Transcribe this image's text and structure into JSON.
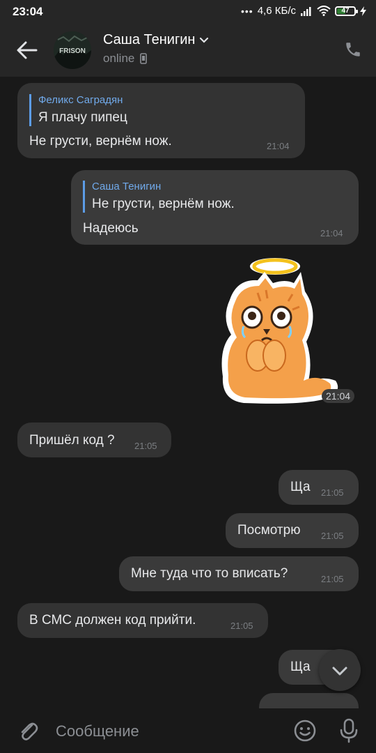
{
  "status_bar": {
    "time": "23:04",
    "dots": "•••",
    "network_speed": "4,6 КБ/с",
    "battery_percent": "47",
    "battery_level": 0.47
  },
  "header": {
    "contact_name": "Саша Тенигин",
    "status": "online",
    "avatar_text": "FRISON"
  },
  "messages": [
    {
      "id": 1,
      "direction": "in",
      "reply_author": "Феликс Саградян",
      "reply_text": "Я плачу пипец",
      "text": "Не грусти, вернём нож.",
      "time": "21:04"
    },
    {
      "id": 2,
      "direction": "out",
      "reply_author": "Саша Тенигин",
      "reply_text": "Не грусти, вернём нож.",
      "text": "Надеюсь",
      "time": "21:04"
    },
    {
      "id": 3,
      "direction": "out",
      "type": "sticker",
      "sticker": "crying-cat-with-halo",
      "time": "21:04"
    },
    {
      "id": 4,
      "direction": "in",
      "text": "Пришёл код ?",
      "time": "21:05"
    },
    {
      "id": 5,
      "direction": "out",
      "text": "Ща",
      "time": "21:05"
    },
    {
      "id": 6,
      "direction": "out",
      "text": "Посмотрю",
      "time": "21:05"
    },
    {
      "id": 7,
      "direction": "out",
      "text": "Мне туда что то вписать?",
      "time": "21:05"
    },
    {
      "id": 8,
      "direction": "in",
      "text": "В СМС должен код прийти.",
      "time": "21:05"
    },
    {
      "id": 9,
      "direction": "out",
      "text": "Ща"
    }
  ],
  "composer": {
    "placeholder": "Сообщение"
  },
  "icons": {
    "back": "arrow-left-icon",
    "phone": "phone-icon",
    "dropdown": "chevron-down-icon",
    "device": "mobile-device-icon",
    "attach": "paperclip-icon",
    "emoji": "smiley-icon",
    "mic": "microphone-icon",
    "scroll": "chevron-down-icon"
  },
  "colors": {
    "background": "#191919",
    "bar": "#262626",
    "bubble_in": "#333333",
    "bubble_out": "#3a3a3a",
    "accent": "#71aaeb"
  }
}
